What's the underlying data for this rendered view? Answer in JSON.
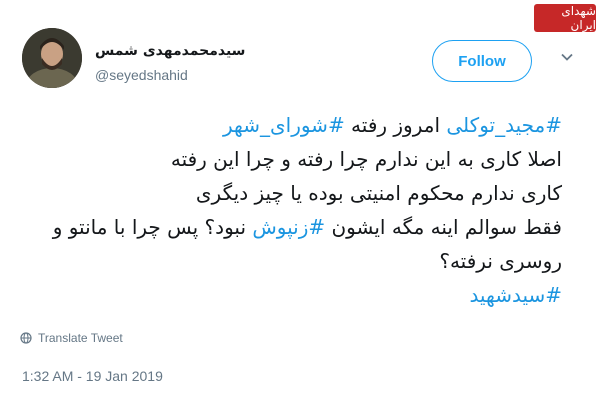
{
  "watermark": {
    "text": "شهدای ایران"
  },
  "author": {
    "display_name": "سیدمحمدمهدی شمس",
    "handle": "@seyedshahid"
  },
  "actions": {
    "follow_label": "Follow"
  },
  "tweet": {
    "line1": {
      "hashtag1": "#مجید_توکلی",
      "text": " امروز رفته ",
      "hashtag2": "#شورای_شهر"
    },
    "line2": "اصلا کاری به این ندارم چرا رفته و چرا این رفته",
    "line3": "کاری ندارم محکوم امنیتی بوده یا چیز دیگری",
    "line4": {
      "before": "فقط سوالم اینه مگه ایشون ",
      "hashtag": "#زنپوش",
      "after": " نبود؟ پس چرا با مانتو و"
    },
    "line5": "روسری نرفته؟",
    "line6": {
      "hashtag": "#سیدشهید"
    }
  },
  "translate_label": "Translate Tweet",
  "timestamp": "1:32 AM - 19 Jan 2019",
  "colors": {
    "accent": "#1da1f2",
    "hashtag": "#1b95e0",
    "muted": "#657786"
  },
  "icons": {
    "globe": "globe-icon",
    "chevron": "chevron-down-icon",
    "avatar": "avatar"
  }
}
